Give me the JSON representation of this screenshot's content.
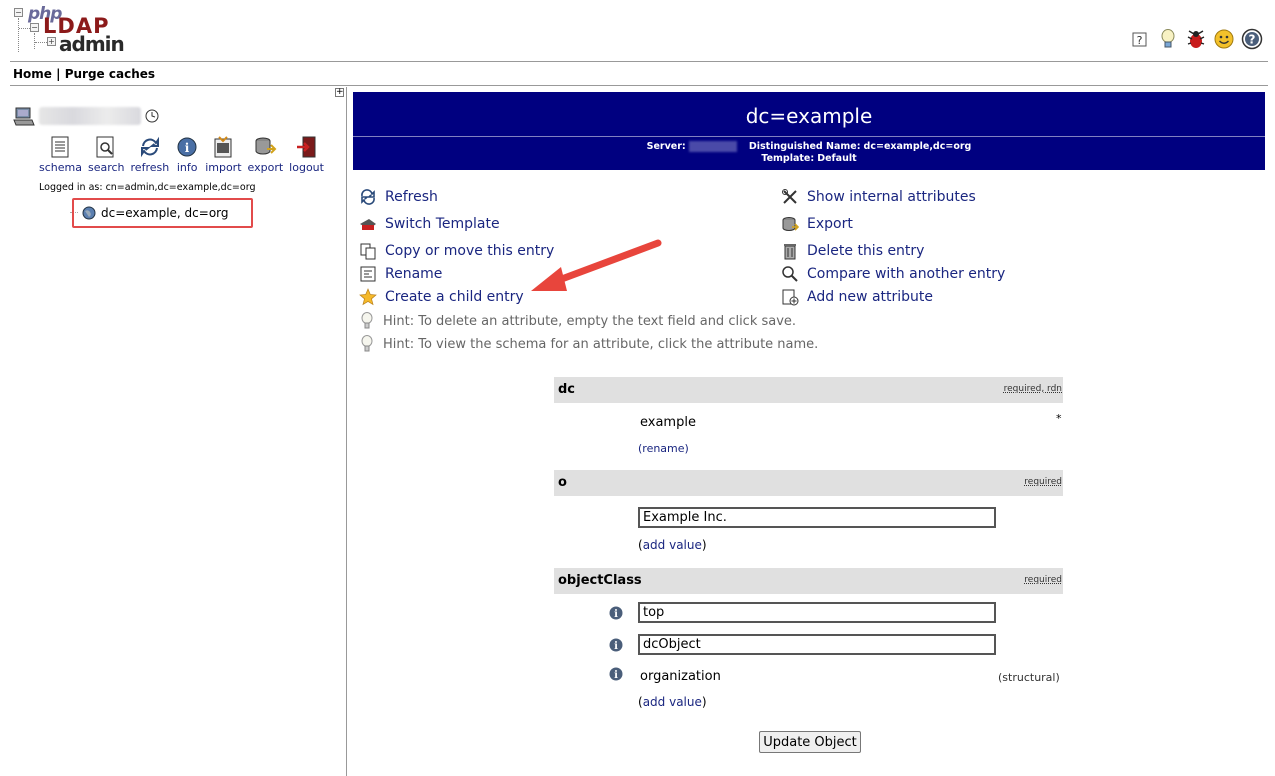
{
  "app": {
    "logo": {
      "php": "php",
      "ldap": "LDAP",
      "admin": "admin"
    }
  },
  "top_icons": [
    "help-icon",
    "hint-bulb-icon",
    "bug-icon",
    "smiley-icon",
    "question-icon"
  ],
  "nav": {
    "home": "Home",
    "separator": "|",
    "purge": "Purge caches"
  },
  "sidebar": {
    "expand_symbol": "+",
    "tools": [
      {
        "label": "schema",
        "icon": "schema-icon"
      },
      {
        "label": "search",
        "icon": "search-icon"
      },
      {
        "label": "refresh",
        "icon": "refresh-icon"
      },
      {
        "label": "info",
        "icon": "info-icon"
      },
      {
        "label": "import",
        "icon": "import-icon"
      },
      {
        "label": "export",
        "icon": "export-icon"
      },
      {
        "label": "logout",
        "icon": "logout-icon"
      }
    ],
    "logged_in_as": "Logged in as: cn=admin,dc=example,dc=org",
    "tree_node": "dc=example, dc=org"
  },
  "main": {
    "title": "dc=example",
    "server_label": "Server:",
    "dn_label": "Distinguished Name:",
    "dn_value": "dc=example,dc=org",
    "template_label": "Template:",
    "template_value": "Default",
    "actions_left": [
      "Refresh",
      "Switch Template",
      "Copy or move this entry",
      "Rename",
      "Create a child entry"
    ],
    "actions_right": [
      "Show internal attributes",
      "Export",
      "Delete this entry",
      "Compare with another entry",
      "Add new attribute"
    ],
    "hints": [
      "Hint: To delete an attribute, empty the text field and click save.",
      "Hint: To view the schema for an attribute, click the attribute name."
    ]
  },
  "attributes": {
    "dc": {
      "name": "dc",
      "flags": "required, rdn",
      "value": "example",
      "marker": "*",
      "rename_link": "(rename)"
    },
    "o": {
      "name": "o",
      "flags": "required",
      "value": "Example Inc.",
      "add_value_open": "(",
      "add_value_link": "add value",
      "add_value_close": ")"
    },
    "objectClass": {
      "name": "objectClass",
      "flags": "required",
      "values": [
        "top",
        "dcObject"
      ],
      "static_value": "organization",
      "structural_note": "(structural)",
      "add_value_open": "(",
      "add_value_link": "add value",
      "add_value_close": ")"
    }
  },
  "update_button": "Update Object",
  "colors": {
    "title_bg": "#000080",
    "link": "#1a2680",
    "highlight_box": "#e24b4b",
    "arrow": "#e8453c",
    "attr_header_bg": "#e0e0e0"
  }
}
